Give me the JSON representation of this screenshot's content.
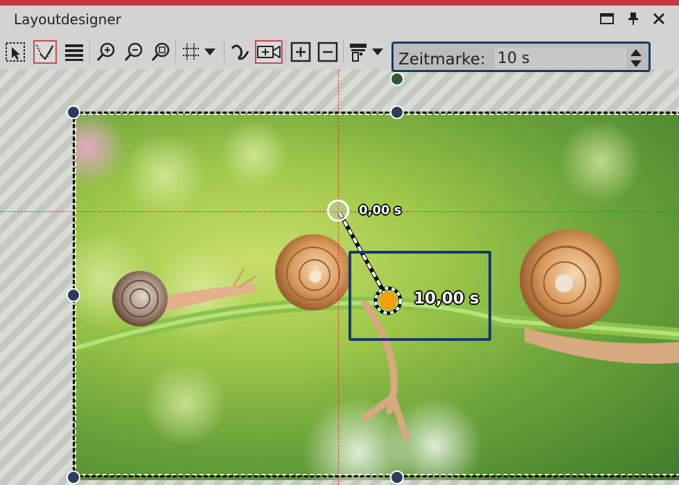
{
  "window": {
    "title": "Layoutdesigner",
    "accent_color": "#c8393c",
    "buttons": [
      "maximize-icon",
      "pin-icon",
      "close-icon"
    ]
  },
  "toolbar": {
    "tools": [
      "select-mode-icon",
      "motion-path-icon",
      "layers-icon",
      "zoom-in-icon",
      "zoom-out-icon",
      "zoom-fit-icon",
      "grid-icon",
      "curve-path-icon",
      "camera-pan-icon",
      "add-keyframe-icon",
      "remove-keyframe-icon",
      "align-icon"
    ],
    "active_tools": [
      "motion-path-icon",
      "camera-pan-icon"
    ]
  },
  "zeitmarke": {
    "label": "Zeitmarke:",
    "value": "10 s",
    "border_color": "#153b64"
  },
  "canvas": {
    "keyframe_start_label": "0,00 s",
    "keyframe_end_label": "10,00 s",
    "keyframe_end_color": "#f0a010"
  }
}
